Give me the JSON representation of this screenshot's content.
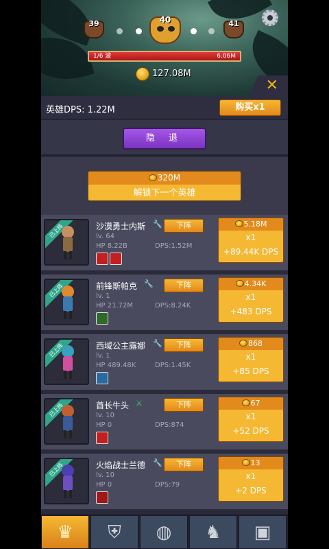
{
  "stages": {
    "prev": "39",
    "current": "40",
    "next": "41"
  },
  "wave": {
    "label": "1/6 波",
    "hp": "6.06M",
    "progress": 1.0
  },
  "gold": "127.08M",
  "header": {
    "hero_dps": "英雄DPS: 1.22M",
    "buy_label": "购买x1",
    "hide_label": "隐 退"
  },
  "unlock": {
    "cost": "320M",
    "label": "解锁下一个英雄"
  },
  "colors": {
    "accent_orange": "#f5b833",
    "cost_orange": "#e38a1c",
    "purple": "#9a4ad8",
    "ribbon_teal": "#2fa68a",
    "wave_red": "#e43838"
  },
  "heroes": [
    {
      "ribbon": "已上阵",
      "name": "沙漠勇士内斯",
      "tool_icon": "wrench-icon",
      "level": "lv. 64",
      "hp": "HP 8.22B",
      "dps": "DPS:1.52M",
      "retire": "下阵",
      "cost": "5.18M",
      "mult": "x1",
      "gain": "+89.44K DPS",
      "skills": [
        "fire-skill-icon",
        "fire-skill-icon"
      ]
    },
    {
      "ribbon": "已上阵",
      "name": "前锋斯帕克",
      "tool_icon": "wrench-icon",
      "level": "lv. 1",
      "hp": "HP 21.72M",
      "dps": "DPS:8.24K",
      "retire": "下阵",
      "cost": "4.34K",
      "mult": "x1",
      "gain": "+483 DPS",
      "skills": [
        "lightning-skill-icon"
      ]
    },
    {
      "ribbon": "已上阵",
      "name": "西域公主露娜",
      "tool_icon": "wrench-icon",
      "level": "lv. 1",
      "hp": "HP 489.48K",
      "dps": "DPS:1.45K",
      "retire": "下阵",
      "cost": "868",
      "mult": "x1",
      "gain": "+85 DPS",
      "skills": [
        "ice-skill-icon"
      ]
    },
    {
      "ribbon": "已上阵",
      "name": "酋长牛头",
      "tool_icon": "swords-icon",
      "level": "lv. 10",
      "hp": "HP 0",
      "dps": "DPS:874",
      "retire": "下阵",
      "cost": "67",
      "mult": "x1",
      "gain": "+52 DPS",
      "skills": [
        "fire-skill-icon"
      ]
    },
    {
      "ribbon": "已上阵",
      "name": "火焰战士兰德",
      "tool_icon": "wrench-icon",
      "level": "lv. 10",
      "hp": "HP 0",
      "dps": "DPS:79",
      "retire": "下阵",
      "cost": "13",
      "mult": "x1",
      "gain": "+2 DPS",
      "skills": [
        "shield-skill-icon"
      ]
    }
  ],
  "nav": [
    {
      "icon": "crown-icon",
      "active": true
    },
    {
      "icon": "sword-shield-icon",
      "active": false
    },
    {
      "icon": "egg-icon",
      "active": false
    },
    {
      "icon": "knight-helmet-icon",
      "active": false
    },
    {
      "icon": "treasure-chest-icon",
      "active": false
    }
  ]
}
